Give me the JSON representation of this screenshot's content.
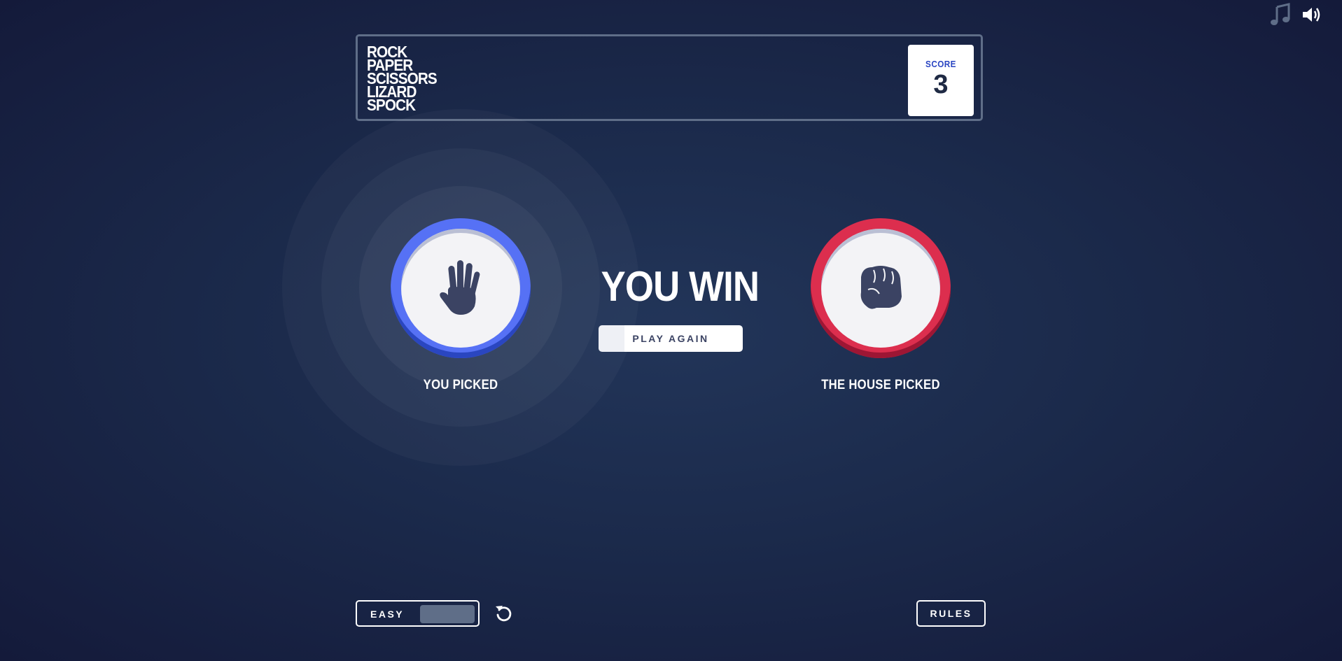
{
  "audio": {
    "music_icon": "music-note-icon",
    "volume_icon": "speaker-volume-icon"
  },
  "header": {
    "logo_lines": [
      "ROCK",
      "PAPER",
      "SCISSORS",
      "LIZARD",
      "SPOCK"
    ],
    "score_label": "SCORE",
    "score_value": "3"
  },
  "game": {
    "player_choice": "paper",
    "player_label": "YOU PICKED",
    "house_choice": "rock",
    "house_label": "THE HOUSE PICKED",
    "result": "YOU WIN",
    "play_again_label": "PLAY AGAIN"
  },
  "footer": {
    "mode_label": "EASY",
    "reset_icon": "reset-icon",
    "rules_label": "RULES"
  },
  "colors": {
    "paper": "#5671f5",
    "rock": "#dc2e4e",
    "score_label": "#2a45c2",
    "header_border": "#5f6e88"
  }
}
